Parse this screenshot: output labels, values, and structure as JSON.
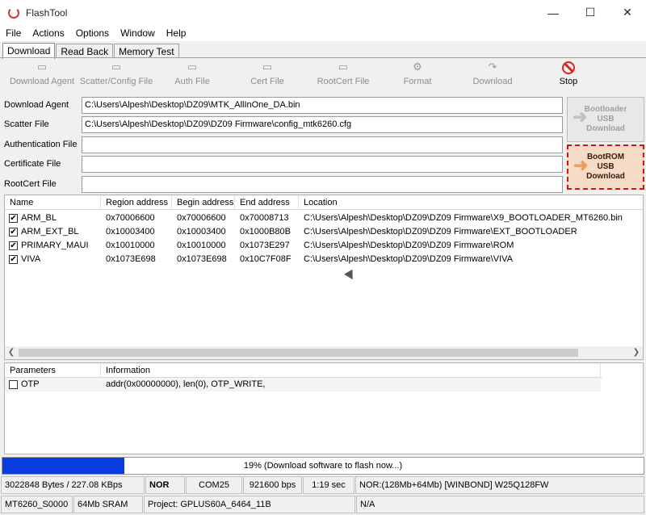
{
  "window": {
    "title": "FlashTool",
    "controls": [
      "—",
      "☐",
      "✕"
    ]
  },
  "menu": [
    "File",
    "Actions",
    "Options",
    "Window",
    "Help"
  ],
  "tabs": [
    "Download",
    "Read Back",
    "Memory Test"
  ],
  "toolbar": {
    "download_agent": "Download Agent",
    "scatter_config": "Scatter/Config File",
    "auth_file": "Auth File",
    "cert_file": "Cert File",
    "rootcert_file": "RootCert File",
    "format": "Format",
    "download": "Download",
    "stop": "Stop"
  },
  "files": {
    "download_agent": {
      "label": "Download Agent",
      "value": "C:\\Users\\Alpesh\\Desktop\\DZ09\\MTK_AllInOne_DA.bin"
    },
    "scatter_file": {
      "label": "Scatter File",
      "value": "C:\\Users\\Alpesh\\Desktop\\DZ09\\DZ09 Firmware\\config_mtk6260.cfg"
    },
    "authentication_file": {
      "label": "Authentication File",
      "value": ""
    },
    "certificate_file": {
      "label": "Certificate File",
      "value": ""
    },
    "rootcert_file": {
      "label": "RootCert File",
      "value": ""
    }
  },
  "side_buttons": {
    "bootloader": {
      "line1": "Bootloader",
      "line2": "USB",
      "line3": "Download"
    },
    "bootrom": {
      "line1": "BootROM",
      "line2": "USB",
      "line3": "Download"
    }
  },
  "regions_table": {
    "headers": [
      "Name",
      "Region address",
      "Begin address",
      "End address",
      "Location"
    ],
    "rows": [
      {
        "name": "ARM_BL",
        "region": "0x70006600",
        "begin": "0x70006600",
        "end": "0x70008713",
        "location": "C:\\Users\\Alpesh\\Desktop\\DZ09\\DZ09 Firmware\\X9_BOOTLOADER_MT6260.bin"
      },
      {
        "name": "ARM_EXT_BL",
        "region": "0x10003400",
        "begin": "0x10003400",
        "end": "0x1000B80B",
        "location": "C:\\Users\\Alpesh\\Desktop\\DZ09\\DZ09 Firmware\\EXT_BOOTLOADER"
      },
      {
        "name": "PRIMARY_MAUI",
        "region": "0x10010000",
        "begin": "0x10010000",
        "end": "0x1073E297",
        "location": "C:\\Users\\Alpesh\\Desktop\\DZ09\\DZ09 Firmware\\ROM"
      },
      {
        "name": "VIVA",
        "region": "0x1073E698",
        "begin": "0x1073E698",
        "end": "0x10C7F08F",
        "location": "C:\\Users\\Alpesh\\Desktop\\DZ09\\DZ09 Firmware\\VIVA"
      }
    ]
  },
  "params_table": {
    "headers": [
      "Parameters",
      "Information"
    ],
    "rows": [
      {
        "name": "OTP",
        "info": "addr(0x00000000), len(0), OTP_WRITE,"
      }
    ]
  },
  "progress": {
    "percent": 19,
    "text": "19% (Download software to flash now...)",
    "color": "#0a3ce0"
  },
  "status1": {
    "bytes": "3022848 Bytes / 227.08 KBps",
    "flash": "NOR",
    "port": "COM25",
    "baud": "921600 bps",
    "time": "1:19 sec",
    "flash_info": "NOR:(128Mb+64Mb) [WINBOND] W25Q128FW"
  },
  "status2": {
    "chip": "MT6260_S0000",
    "sram": "64Mb SRAM",
    "project": "Project: GPLUS60A_6464_11B",
    "na": "N/A"
  }
}
